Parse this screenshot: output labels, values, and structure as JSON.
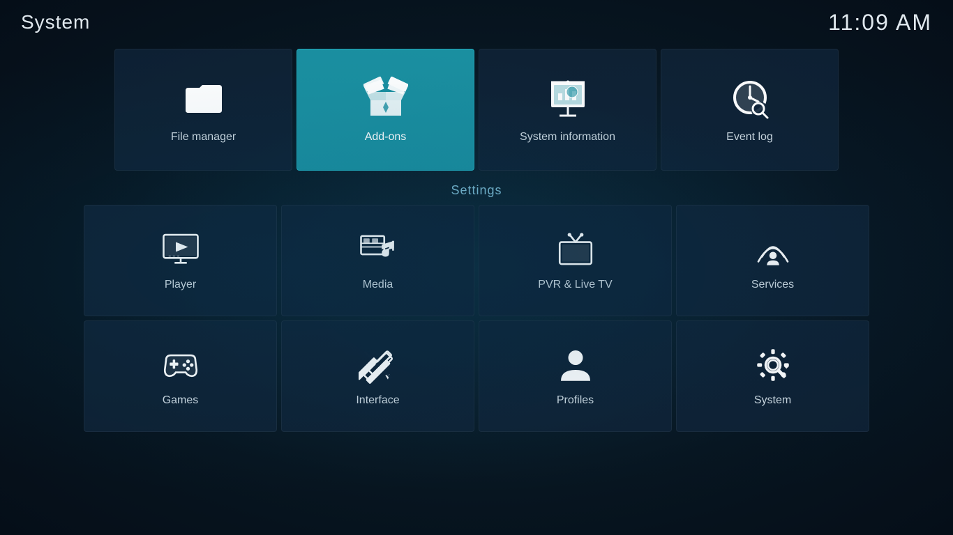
{
  "header": {
    "title": "System",
    "time": "11:09 AM"
  },
  "top_row": [
    {
      "id": "file-manager",
      "label": "File manager",
      "active": false
    },
    {
      "id": "add-ons",
      "label": "Add-ons",
      "active": true
    },
    {
      "id": "system-information",
      "label": "System information",
      "active": false
    },
    {
      "id": "event-log",
      "label": "Event log",
      "active": false
    }
  ],
  "settings": {
    "header": "Settings",
    "items": [
      {
        "id": "player",
        "label": "Player"
      },
      {
        "id": "media",
        "label": "Media"
      },
      {
        "id": "pvr-live-tv",
        "label": "PVR & Live TV"
      },
      {
        "id": "services",
        "label": "Services"
      },
      {
        "id": "games",
        "label": "Games"
      },
      {
        "id": "interface",
        "label": "Interface"
      },
      {
        "id": "profiles",
        "label": "Profiles"
      },
      {
        "id": "system",
        "label": "System"
      }
    ]
  }
}
